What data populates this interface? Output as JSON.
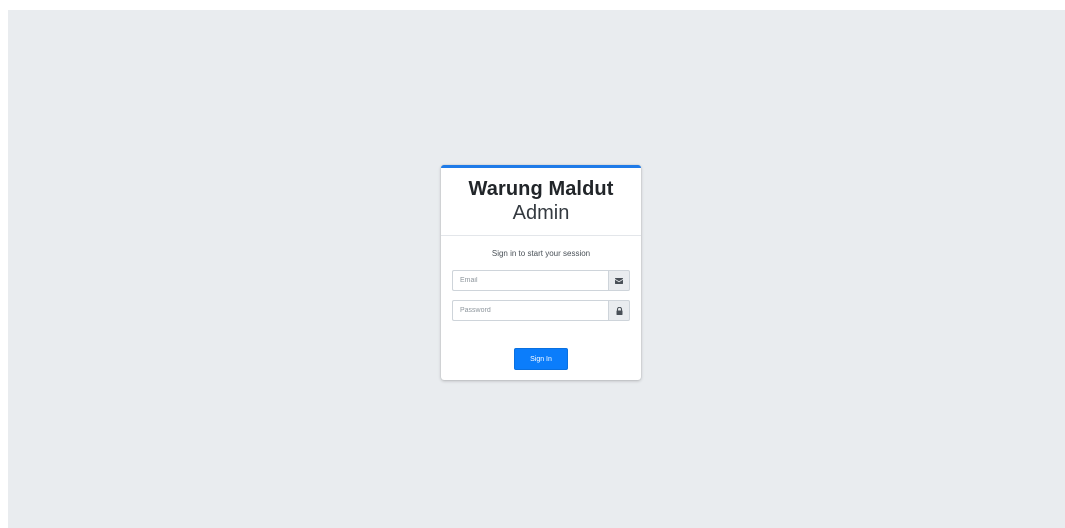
{
  "brand": {
    "title": "Warung Maldut",
    "subtitle": "Admin"
  },
  "login": {
    "message": "Sign in to start your session",
    "email": {
      "placeholder": "Email",
      "value": "",
      "icon": "envelope-icon"
    },
    "password": {
      "placeholder": "Password",
      "value": "",
      "icon": "lock-icon"
    },
    "submit_label": "Sign In"
  },
  "colors": {
    "page_background": "#e9ecef",
    "card_accent": "#1f7be8",
    "button_primary": "#0b7dfb",
    "addon_background": "#e9ecef"
  }
}
